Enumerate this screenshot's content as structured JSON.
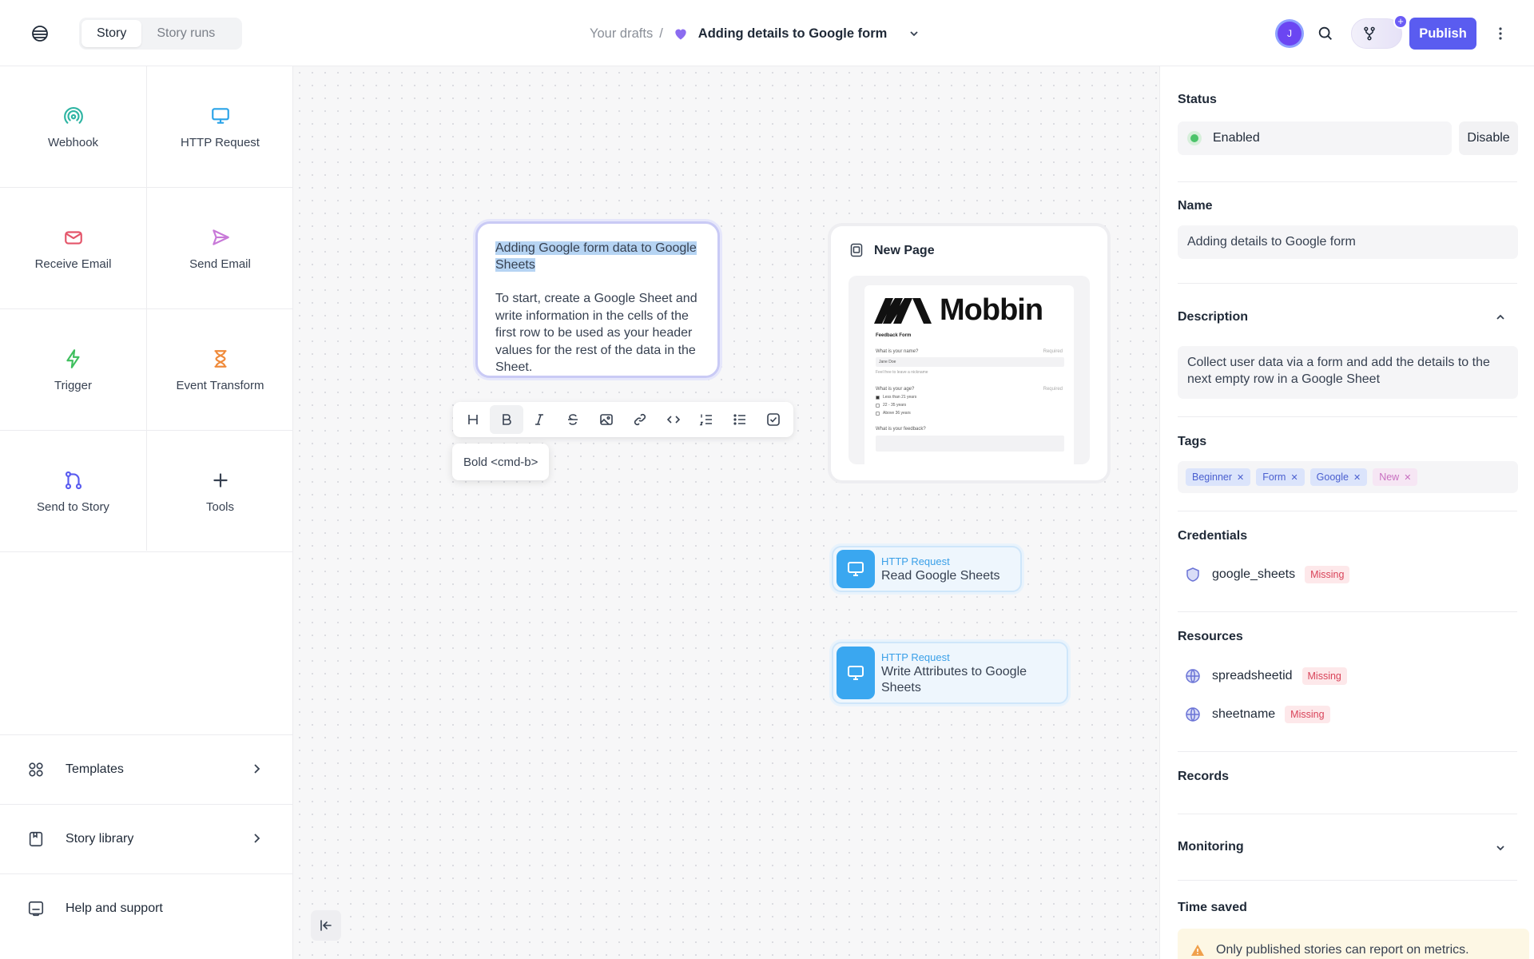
{
  "header": {
    "tabs": [
      {
        "label": "Story",
        "active": true
      },
      {
        "label": "Story runs",
        "active": false
      }
    ],
    "breadcrumb": {
      "parent": "Your drafts",
      "separator": "/",
      "title": "Adding details to Google form"
    },
    "avatar_initial": "J",
    "branch_badge": "+",
    "publish_label": "Publish",
    "colors": {
      "accent": "#5a5cf0",
      "avatar": "#6b46f2"
    }
  },
  "sidebar": {
    "tools": [
      {
        "label": "Webhook",
        "icon": "webhook-icon",
        "color": "#2fb5a3"
      },
      {
        "label": "HTTP Request",
        "icon": "monitor-icon",
        "color": "#2aa3e8"
      },
      {
        "label": "Receive Email",
        "icon": "envelope-icon",
        "color": "#e4556a"
      },
      {
        "label": "Send Email",
        "icon": "send-icon",
        "color": "#c879d8"
      },
      {
        "label": "Trigger",
        "icon": "lightning-icon",
        "color": "#3fbf5e"
      },
      {
        "label": "Event Transform",
        "icon": "hourglass-icon",
        "color": "#ef8a3a"
      },
      {
        "label": "Send to Story",
        "icon": "git-branch-icon",
        "color": "#5a5cf0"
      },
      {
        "label": "Tools",
        "icon": "plus-icon",
        "color": "#374151"
      }
    ],
    "links": [
      {
        "label": "Templates",
        "icon": "grid-icon",
        "chevron": true
      },
      {
        "label": "Story library",
        "icon": "book-icon",
        "chevron": true
      },
      {
        "label": "Help and support",
        "icon": "help-icon",
        "chevron": false
      }
    ]
  },
  "canvas": {
    "note": {
      "title": "Adding Google form data to Google Sheets",
      "body": "To start, create a Google Sheet and write information in the cells of the first row to be used as your header values for the rest of the data in the Sheet."
    },
    "format_bar": {
      "buttons": [
        "heading",
        "bold",
        "italic",
        "strikethrough",
        "image",
        "link",
        "code",
        "ordered-list",
        "bullet-list",
        "checklist"
      ],
      "active": "bold"
    },
    "tooltip": "Bold <cmd-b>",
    "page_card": {
      "title": "New Page",
      "preview": {
        "brand": "Mobbin",
        "form_title": "Feedback Form",
        "q1": "What is your name?",
        "q1_required": "Required",
        "q1_value": "Jane Doe",
        "q1_hint": "Feel free to leave a nickname",
        "q2": "What is your age?",
        "q2_required": "Required",
        "q2_options": [
          "Less than 21 years",
          "22 - 35 years",
          "Above 36 years"
        ],
        "q3": "What is your feedback?"
      }
    },
    "actions": [
      {
        "type": "HTTP Request",
        "name": "Read Google Sheets"
      },
      {
        "type": "HTTP Request",
        "name": "Write Attributes to Google Sheets"
      }
    ]
  },
  "panel": {
    "status": {
      "title": "Status",
      "value": "Enabled",
      "action": "Disable"
    },
    "name": {
      "title": "Name",
      "value": "Adding details to Google form"
    },
    "description": {
      "title": "Description",
      "value": "Collect user data via a form and add the details to the next empty row in a Google Sheet"
    },
    "tags": {
      "title": "Tags",
      "items": [
        {
          "label": "Beginner",
          "style": "blue"
        },
        {
          "label": "Form",
          "style": "blue"
        },
        {
          "label": "Google",
          "style": "blue"
        },
        {
          "label": "New",
          "style": "pink"
        }
      ]
    },
    "credentials": {
      "title": "Credentials",
      "items": [
        {
          "name": "google_sheets",
          "badge": "Missing"
        }
      ]
    },
    "resources": {
      "title": "Resources",
      "items": [
        {
          "name": "spreadsheetid",
          "badge": "Missing"
        },
        {
          "name": "sheetname",
          "badge": "Missing"
        }
      ]
    },
    "records": {
      "title": "Records"
    },
    "monitoring": {
      "title": "Monitoring"
    },
    "time_saved": {
      "title": "Time saved",
      "warning": "Only published stories can report on metrics."
    }
  }
}
